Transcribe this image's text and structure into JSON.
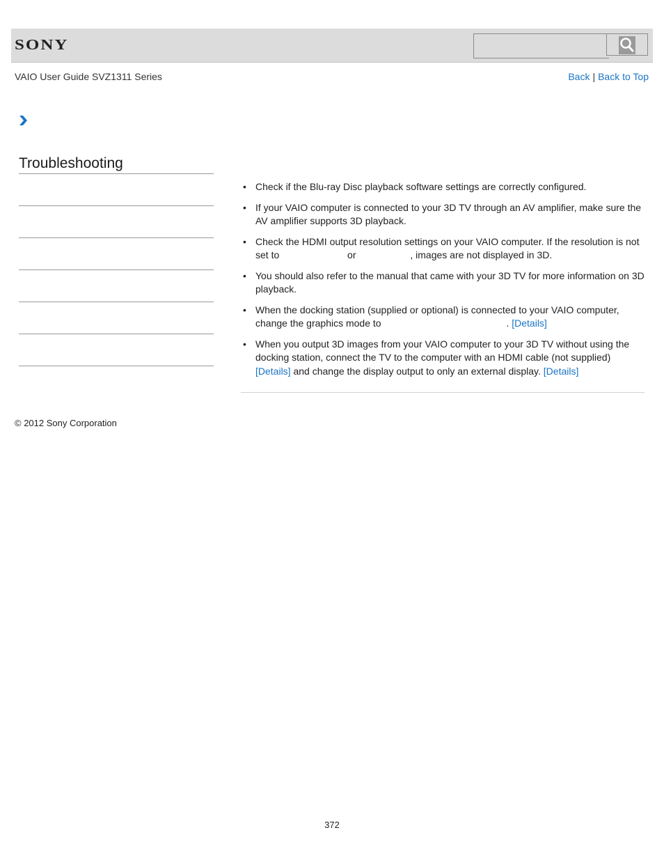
{
  "header": {
    "logo_text": "SONY",
    "search": {
      "placeholder": "",
      "value": ""
    },
    "search_button_icon": "search-icon"
  },
  "subheader": {
    "guide_title": "VAIO User Guide SVZ1311 Series",
    "nav": {
      "back_label": "Back",
      "separator": "|",
      "back_to_top_label": "Back to Top"
    }
  },
  "breadcrumb": {
    "icon": "chevron-right-icon",
    "color": "#1a74c4"
  },
  "sidebar": {
    "title": "Troubleshooting",
    "items": [
      {
        "label": ""
      },
      {
        "label": ""
      },
      {
        "label": ""
      },
      {
        "label": ""
      },
      {
        "label": ""
      },
      {
        "label": ""
      }
    ]
  },
  "content": {
    "bullets": [
      {
        "text": "Check if the Blu-ray Disc playback software settings are correctly configured."
      },
      {
        "text": "If your VAIO computer is connected to your 3D TV through an AV amplifier, make sure the AV amplifier supports 3D playback."
      },
      {
        "text_a": "Check the HDMI output resolution settings on your VAIO computer. If the resolution is not set to",
        "text_b": "or",
        "text_c": ", images are not displayed in 3D."
      },
      {
        "text": "You should also refer to the manual that came with your 3D TV for more information on 3D playback."
      },
      {
        "text_a": "When the docking station (supplied or optional) is connected to your VAIO computer, change the graphics mode to",
        "text_b": ".",
        "link": "[Details]"
      },
      {
        "text_a": "When you output 3D images from your VAIO computer to your 3D TV without using the docking station, connect the TV to the computer with an HDMI cable (not supplied)",
        "link_1": "[Details]",
        "text_b": "and change the display output to only an external display.",
        "link_2": "[Details]"
      }
    ]
  },
  "footer": {
    "copyright": "© 2012 Sony Corporation",
    "page_number": "372"
  },
  "colors": {
    "link": "#1a74c4",
    "header_bg": "#dcdcdc",
    "divider": "#999999"
  }
}
